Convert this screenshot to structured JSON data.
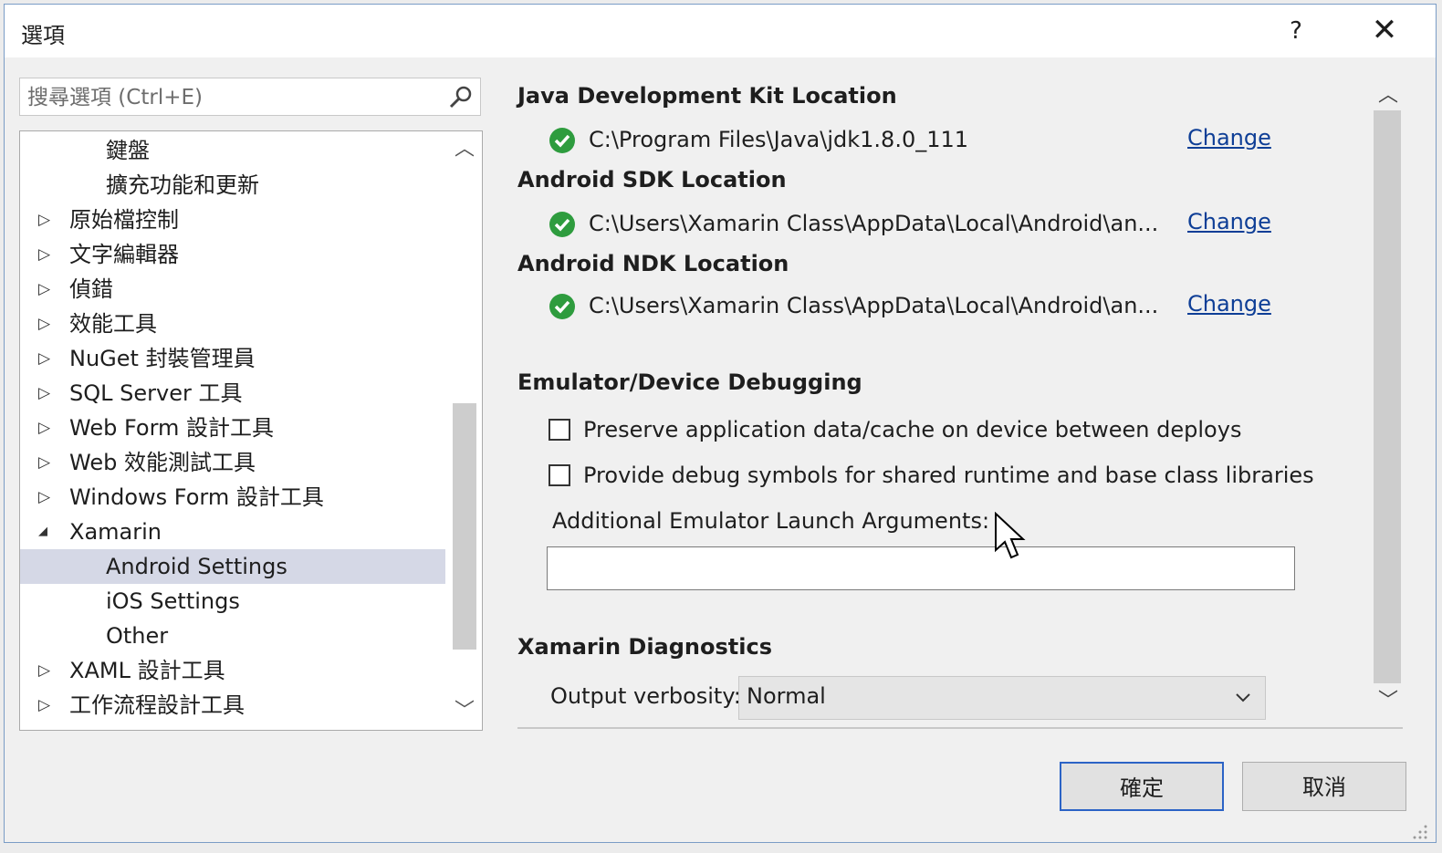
{
  "window": {
    "title": "選項",
    "help": "?",
    "close": "✕"
  },
  "search": {
    "placeholder": "搜尋選項 (Ctrl+E)"
  },
  "tree": {
    "items": [
      {
        "label": "鍵盤",
        "level": 2
      },
      {
        "label": "擴充功能和更新",
        "level": 2
      },
      {
        "label": "原始檔控制",
        "level": 1,
        "arrow": "▷"
      },
      {
        "label": "文字編輯器",
        "level": 1,
        "arrow": "▷"
      },
      {
        "label": "偵錯",
        "level": 1,
        "arrow": "▷"
      },
      {
        "label": "效能工具",
        "level": 1,
        "arrow": "▷"
      },
      {
        "label": "NuGet 封裝管理員",
        "level": 1,
        "arrow": "▷"
      },
      {
        "label": "SQL Server 工具",
        "level": 1,
        "arrow": "▷"
      },
      {
        "label": "Web Form 設計工具",
        "level": 1,
        "arrow": "▷"
      },
      {
        "label": "Web 效能測試工具",
        "level": 1,
        "arrow": "▷"
      },
      {
        "label": "Windows Form 設計工具",
        "level": 1,
        "arrow": "▷"
      },
      {
        "label": "Xamarin",
        "level": 1,
        "arrow": "◢"
      },
      {
        "label": "Android Settings",
        "level": 2,
        "selected": true
      },
      {
        "label": "iOS Settings",
        "level": 2
      },
      {
        "label": "Other",
        "level": 2
      },
      {
        "label": "XAML 設計工具",
        "level": 1,
        "arrow": "▷"
      },
      {
        "label": "工作流程設計工具",
        "level": 1,
        "arrow": "▷"
      }
    ]
  },
  "jdk": {
    "title": "Java Development Kit Location",
    "path": "C:\\Program Files\\Java\\jdk1.8.0_111",
    "change": "Change"
  },
  "sdk": {
    "title": "Android SDK Location",
    "path": "C:\\Users\\Xamarin Class\\AppData\\Local\\Android\\an...",
    "change": "Change"
  },
  "ndk": {
    "title": "Android NDK Location",
    "path": "C:\\Users\\Xamarin Class\\AppData\\Local\\Android\\an...",
    "change": "Change"
  },
  "debugging": {
    "title": "Emulator/Device Debugging",
    "preserve": "Preserve application data/cache on device between deploys",
    "preserve_checked": false,
    "symbols": "Provide debug symbols for shared runtime and base class libraries",
    "symbols_checked": false,
    "args_label": "Additional Emulator Launch Arguments:",
    "args_value": ""
  },
  "diagnostics": {
    "title": "Xamarin Diagnostics",
    "verbosity_label": "Output verbosity:",
    "verbosity_value": "Normal"
  },
  "buttons": {
    "ok": "確定",
    "cancel": "取消"
  },
  "colors": {
    "link": "#0e3e96",
    "check": "#2e9c3e",
    "selected": "#d5d8e6",
    "ok_border": "#2b63c6"
  }
}
